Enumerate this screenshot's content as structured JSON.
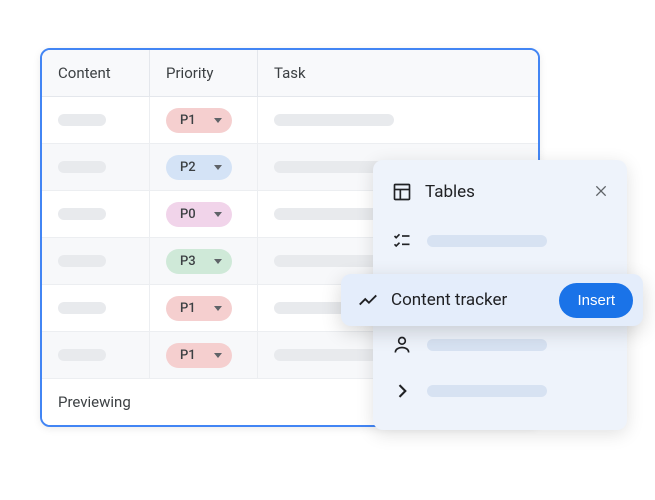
{
  "table": {
    "headers": {
      "content": "Content",
      "priority": "Priority",
      "task": "Task"
    },
    "rows": [
      {
        "priority": "P1",
        "chipClass": "chip-p1",
        "taskLen": "short"
      },
      {
        "priority": "P2",
        "chipClass": "chip-p2",
        "taskLen": "long"
      },
      {
        "priority": "P0",
        "chipClass": "chip-p0",
        "taskLen": "short"
      },
      {
        "priority": "P3",
        "chipClass": "chip-p3",
        "taskLen": "long"
      },
      {
        "priority": "P1",
        "chipClass": "chip-p1",
        "taskLen": "short"
      },
      {
        "priority": "P1",
        "chipClass": "chip-p1",
        "taskLen": "long"
      }
    ],
    "footer": "Previewing"
  },
  "panel": {
    "title": "Tables",
    "activeItem": {
      "label": "Content tracker",
      "button": "Insert"
    }
  }
}
